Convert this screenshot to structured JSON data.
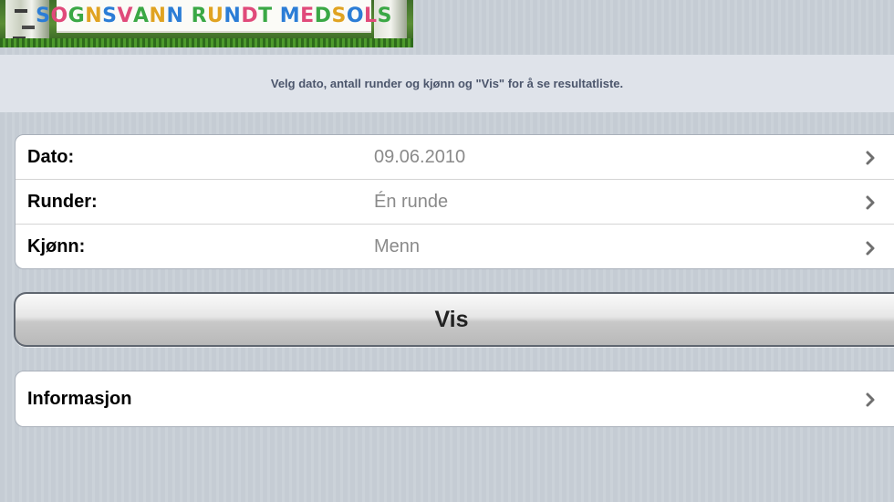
{
  "banner": {
    "text": "SOGNSVANN RUNDT MED SOLS",
    "letters": [
      "S",
      "O",
      "G",
      "N",
      "S",
      "V",
      "A",
      "N",
      "N",
      " ",
      "R",
      "U",
      "N",
      "D",
      "T",
      " ",
      "M",
      "E",
      "D",
      "S",
      "O",
      "L",
      "S"
    ]
  },
  "instruction": "Velg dato, antall runder og kjønn og \"Vis\" for å se resultatliste.",
  "form": {
    "rows": [
      {
        "label": "Dato:",
        "value": "09.06.2010"
      },
      {
        "label": "Runder:",
        "value": "Én runde"
      },
      {
        "label": "Kjønn:",
        "value": "Menn"
      }
    ]
  },
  "vis_button": {
    "label": "Vis"
  },
  "info": {
    "label": "Informasjon"
  },
  "colors": {
    "background": "#c5ccd4",
    "instruction_text": "#4c566c",
    "value_text": "#8a8a8a",
    "chevron": "#6f6f6f"
  },
  "icons": {
    "row_chevron": "chevron-right-icon"
  }
}
